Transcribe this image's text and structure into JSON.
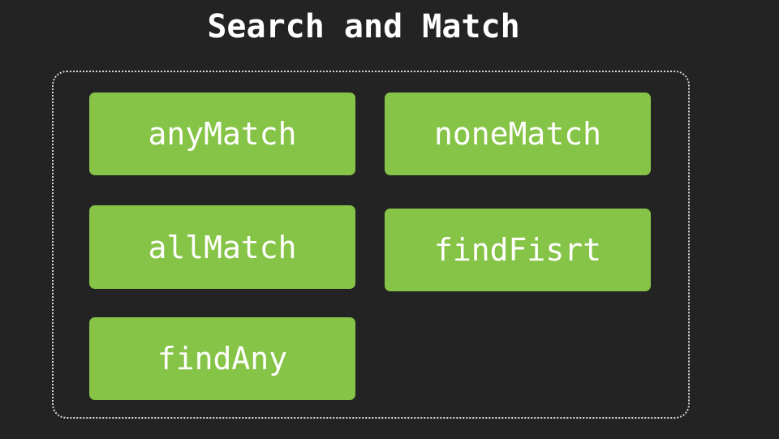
{
  "title": "Search and Match",
  "methods": [
    "anyMatch",
    "noneMatch",
    "allMatch",
    "findFisrt",
    "findAny"
  ],
  "colors": {
    "background": "#232323",
    "tile": "#86c447",
    "text": "#ffffff",
    "frame_border": "#d8d8d8"
  }
}
